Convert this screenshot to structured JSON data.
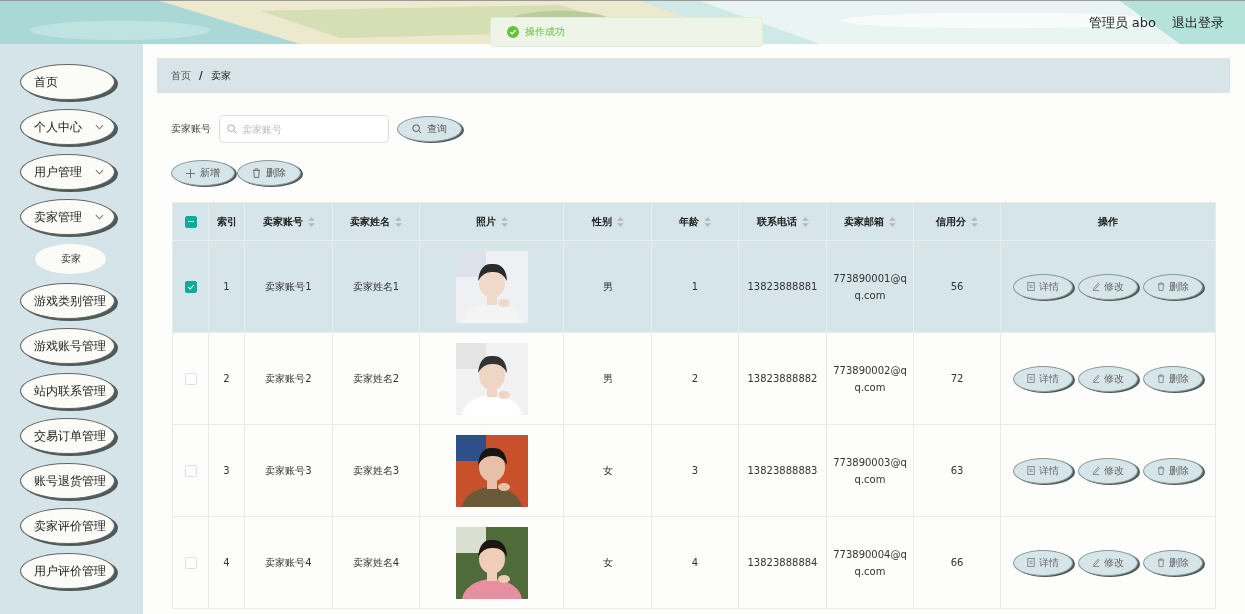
{
  "header": {
    "user": "管理员 abo",
    "logout": "退出登录"
  },
  "toast": {
    "message": "操作成功"
  },
  "sidebar": {
    "items": [
      {
        "label": "首页"
      },
      {
        "label": "个人中心",
        "has_submenu": true
      },
      {
        "label": "用户管理",
        "has_submenu": true
      },
      {
        "label": "卖家管理",
        "has_submenu": true,
        "children": [
          {
            "label": "卖家"
          }
        ]
      },
      {
        "label": "游戏类别管理"
      },
      {
        "label": "游戏账号管理"
      },
      {
        "label": "站内联系管理"
      },
      {
        "label": "交易订单管理"
      },
      {
        "label": "账号退货管理"
      },
      {
        "label": "卖家评价管理"
      },
      {
        "label": "用户评价管理"
      }
    ]
  },
  "breadcrumb": {
    "items": [
      "首页",
      "卖家"
    ],
    "separator": "/"
  },
  "search": {
    "label": "卖家账号",
    "placeholder": "卖家账号",
    "button": "查询"
  },
  "toolbar": [
    {
      "kind": "add",
      "label": "新增"
    },
    {
      "kind": "delete",
      "label": "删除"
    }
  ],
  "table": {
    "select_all": {
      "indeterminate": true
    },
    "columns": [
      {
        "label": "索引",
        "sortable": false
      },
      {
        "label": "卖家账号",
        "sortable": true
      },
      {
        "label": "卖家姓名",
        "sortable": true
      },
      {
        "label": "照片",
        "sortable": true
      },
      {
        "label": "性别",
        "sortable": true
      },
      {
        "label": "年龄",
        "sortable": true
      },
      {
        "label": "联系电话",
        "sortable": true
      },
      {
        "label": "卖家邮箱",
        "sortable": true
      },
      {
        "label": "信用分",
        "sortable": true
      },
      {
        "label": "操作",
        "sortable": false
      }
    ],
    "rows": [
      {
        "selected": true,
        "index": "1",
        "account": "卖家账号1",
        "name": "卖家姓名1",
        "photo": {
          "kind": "picture"
        },
        "gender": "男",
        "age": "1",
        "phone": "13823888881",
        "email": "773890001@qq.com",
        "credit": "56",
        "actions": [
          {
            "kind": "detail",
            "label": "详情"
          },
          {
            "kind": "edit",
            "label": "修改"
          },
          {
            "kind": "delete",
            "label": "删除"
          }
        ]
      },
      {
        "selected": false,
        "index": "2",
        "account": "卖家账号2",
        "name": "卖家姓名2",
        "photo": {
          "kind": "picture"
        },
        "gender": "男",
        "age": "2",
        "phone": "13823888882",
        "email": "773890002@qq.com",
        "credit": "72",
        "actions": [
          {
            "kind": "detail",
            "label": "详情"
          },
          {
            "kind": "edit",
            "label": "修改"
          },
          {
            "kind": "delete",
            "label": "删除"
          }
        ]
      },
      {
        "selected": false,
        "index": "3",
        "account": "卖家账号3",
        "name": "卖家姓名3",
        "photo": {
          "kind": "picture"
        },
        "gender": "女",
        "age": "3",
        "phone": "13823888883",
        "email": "773890003@qq.com",
        "credit": "63",
        "actions": [
          {
            "kind": "detail",
            "label": "详情"
          },
          {
            "kind": "edit",
            "label": "修改"
          },
          {
            "kind": "delete",
            "label": "删除"
          }
        ]
      },
      {
        "selected": false,
        "index": "4",
        "account": "卖家账号4",
        "name": "卖家姓名4",
        "photo": {
          "kind": "picture"
        },
        "gender": "女",
        "age": "4",
        "phone": "13823888884",
        "email": "773890004@qq.com",
        "credit": "66",
        "actions": [
          {
            "kind": "detail",
            "label": "详情"
          },
          {
            "kind": "edit",
            "label": "修改"
          },
          {
            "kind": "delete",
            "label": "删除"
          }
        ]
      }
    ]
  }
}
